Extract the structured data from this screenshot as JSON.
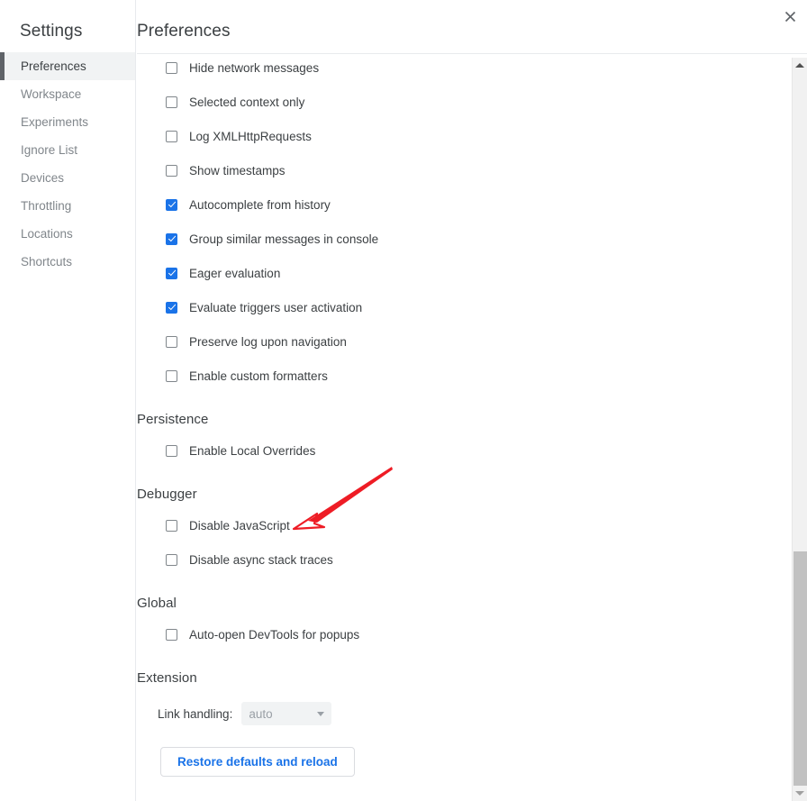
{
  "window": {
    "close_icon": "close-icon"
  },
  "sidebar": {
    "title": "Settings",
    "items": [
      {
        "label": "Preferences",
        "selected": true
      },
      {
        "label": "Workspace",
        "selected": false
      },
      {
        "label": "Experiments",
        "selected": false
      },
      {
        "label": "Ignore List",
        "selected": false
      },
      {
        "label": "Devices",
        "selected": false
      },
      {
        "label": "Throttling",
        "selected": false
      },
      {
        "label": "Locations",
        "selected": false
      },
      {
        "label": "Shortcuts",
        "selected": false
      }
    ]
  },
  "content": {
    "title": "Preferences",
    "console_options": [
      {
        "label": "Hide network messages",
        "checked": false
      },
      {
        "label": "Selected context only",
        "checked": false
      },
      {
        "label": "Log XMLHttpRequests",
        "checked": false
      },
      {
        "label": "Show timestamps",
        "checked": false
      },
      {
        "label": "Autocomplete from history",
        "checked": true
      },
      {
        "label": "Group similar messages in console",
        "checked": true
      },
      {
        "label": "Eager evaluation",
        "checked": true
      },
      {
        "label": "Evaluate triggers user activation",
        "checked": true
      },
      {
        "label": "Preserve log upon navigation",
        "checked": false
      },
      {
        "label": "Enable custom formatters",
        "checked": false
      }
    ],
    "sections": [
      {
        "header": "Persistence",
        "options": [
          {
            "label": "Enable Local Overrides",
            "checked": false
          }
        ]
      },
      {
        "header": "Debugger",
        "options": [
          {
            "label": "Disable JavaScript",
            "checked": false
          },
          {
            "label": "Disable async stack traces",
            "checked": false
          }
        ]
      },
      {
        "header": "Global",
        "options": [
          {
            "label": "Auto-open DevTools for popups",
            "checked": false
          }
        ]
      }
    ],
    "extension": {
      "header": "Extension",
      "field_label": "Link handling:",
      "select_value": "auto",
      "select_caret_icon": "chevron-down-icon"
    },
    "restore_button": "Restore defaults and reload"
  },
  "scrollbar": {
    "up_arrow_icon": "triangle-up-icon",
    "down_arrow_icon": "triangle-down-icon"
  },
  "annotation": {
    "arrow_icon": "red-arrow-icon",
    "color": "#ee1c25",
    "points_to": "Disable JavaScript"
  },
  "colors": {
    "accent": "#1a73e8",
    "selected_bg": "#f1f3f4",
    "text": "#3c4043",
    "muted_text": "#80868b"
  }
}
